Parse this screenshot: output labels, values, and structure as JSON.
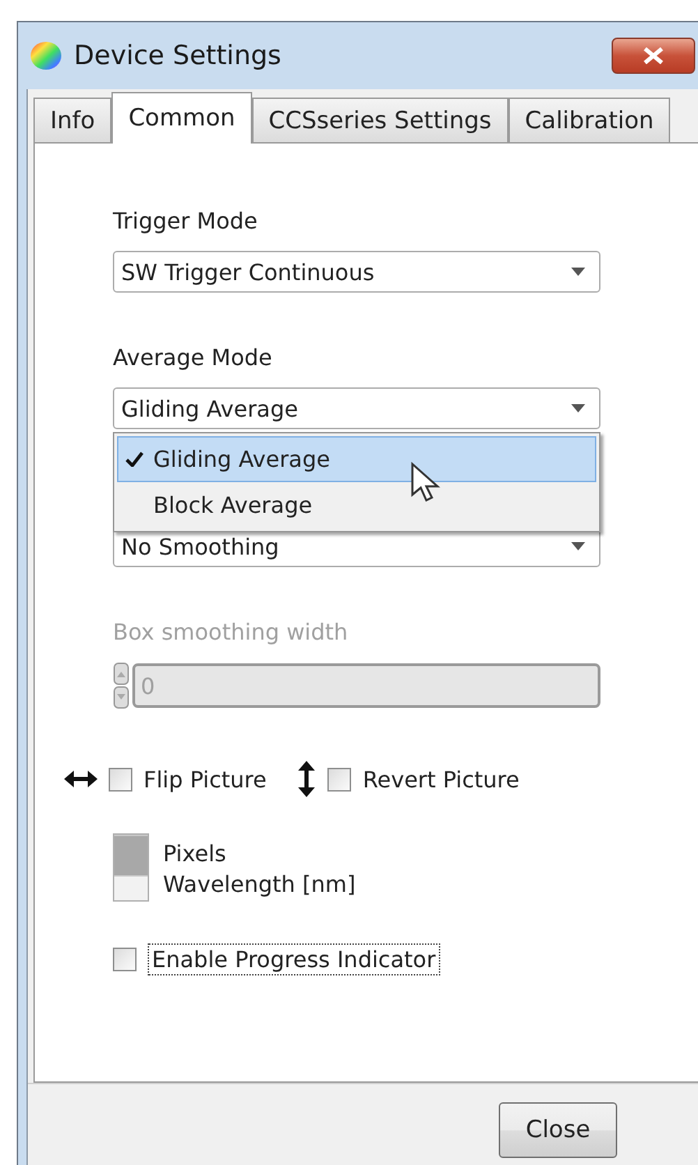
{
  "window": {
    "title": "Device Settings"
  },
  "tabs": [
    {
      "label": "Info",
      "selected": false
    },
    {
      "label": "Common",
      "selected": true
    },
    {
      "label": "CCSseries Settings",
      "selected": false
    },
    {
      "label": "Calibration",
      "selected": false
    }
  ],
  "fields": [
    {
      "kind": "dropdown",
      "label": "Trigger Mode",
      "value": "SW Trigger Continuous",
      "disabled": false
    },
    {
      "kind": "dropdown",
      "label": "Average Mode",
      "value": "Gliding Average",
      "disabled": false,
      "expanded": true,
      "options": [
        {
          "label": "Gliding Average",
          "selected": true
        },
        {
          "label": "Block Average",
          "selected": false
        }
      ]
    },
    {
      "kind": "dropdown",
      "value": "No Smoothing",
      "disabled": false
    },
    {
      "kind": "spinner",
      "label": "Box smoothing width",
      "value": "0",
      "disabled": true
    }
  ],
  "flip_options": [
    {
      "kind": "horizontal",
      "label": "Flip Picture",
      "checked": false
    },
    {
      "kind": "vertical",
      "label": "Revert Picture",
      "checked": false
    }
  ],
  "axis_units": [
    {
      "label": "Pixels",
      "selected": true
    },
    {
      "label": "Wavelength [nm]",
      "selected": false
    }
  ],
  "progress_indicator": {
    "label": "Enable Progress Indicator",
    "checked": false,
    "focused": true
  },
  "buttons": [
    {
      "label": "Close"
    }
  ]
}
